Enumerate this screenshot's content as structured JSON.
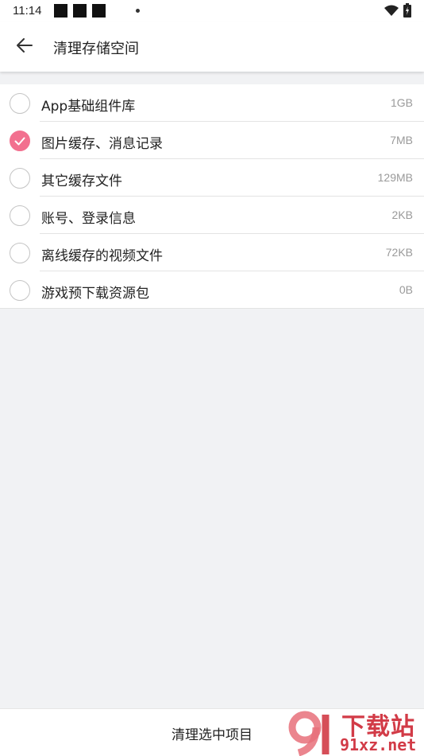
{
  "status_bar": {
    "time": "11:14",
    "icons": [
      "notification-block-icon",
      "notification-block-icon",
      "notification-block-icon",
      "dot-icon",
      "wifi-icon",
      "battery-icon"
    ]
  },
  "app_bar": {
    "back_icon": "arrow-left-icon",
    "title": "清理存储空间"
  },
  "items": [
    {
      "label": "App基础组件库",
      "size": "1GB",
      "checked": false
    },
    {
      "label": "图片缓存、消息记录",
      "size": "7MB",
      "checked": true
    },
    {
      "label": "其它缓存文件",
      "size": "129MB",
      "checked": false
    },
    {
      "label": "账号、登录信息",
      "size": "2KB",
      "checked": false
    },
    {
      "label": "离线缓存的视频文件",
      "size": "72KB",
      "checked": false
    },
    {
      "label": "游戏预下载资源包",
      "size": "0B",
      "checked": false
    }
  ],
  "bottom_bar": {
    "button_label": "清理选中项目"
  },
  "watermark": {
    "title": "下载站",
    "url": "91xz.net",
    "logo_text": "91"
  },
  "colors": {
    "accent": "#f2708f",
    "watermark": "#d23b47"
  }
}
